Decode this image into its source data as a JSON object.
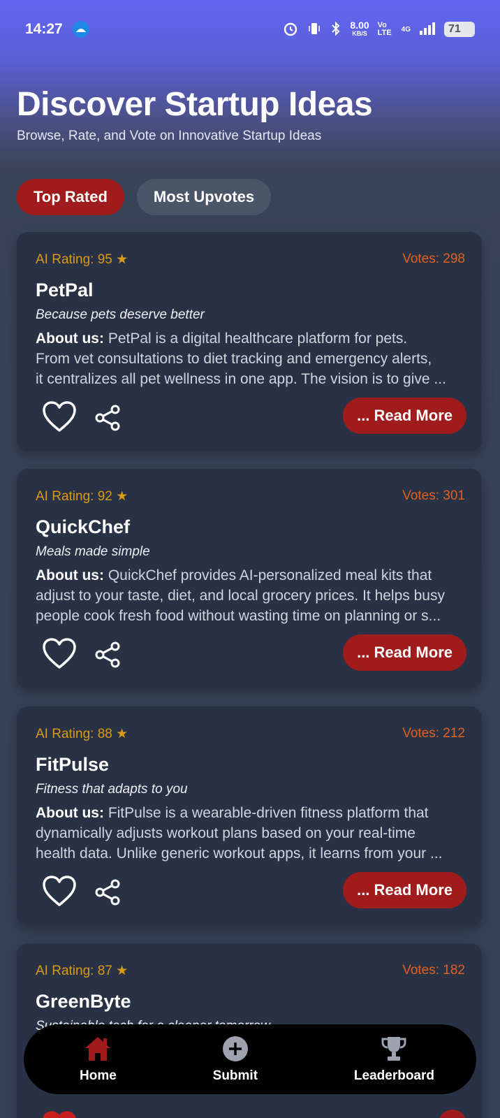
{
  "status_bar": {
    "time": "14:27",
    "speed_value": "8.00",
    "speed_unit": "KB/S",
    "volte": "Vo LTE",
    "network": "4G",
    "battery": "71"
  },
  "header": {
    "title": "Discover Startup Ideas",
    "subtitle": "Browse, Rate, and Vote on Innovative Startup Ideas"
  },
  "tabs": [
    {
      "label": "Top Rated",
      "active": true
    },
    {
      "label": "Most Upvotes",
      "active": false
    }
  ],
  "about_label": "About us:",
  "read_more_label": "... Read More",
  "cards": [
    {
      "rating": "AI Rating: 95 ★",
      "votes": "Votes: 298",
      "name": "PetPal",
      "tagline": "Because pets deserve better",
      "about_lines": [
        " PetPal is a digital healthcare platform for pets.",
        "From vet consultations to diet tracking and emergency alerts,",
        "it centralizes all pet wellness in one app. The vision is to give ..."
      ]
    },
    {
      "rating": "AI Rating: 92 ★",
      "votes": "Votes: 301",
      "name": "QuickChef",
      "tagline": "Meals made simple",
      "about_lines": [
        " QuickChef provides AI-personalized meal kits that",
        "adjust to your taste, diet, and local grocery prices. It helps busy",
        "people cook fresh food without wasting time on planning or s..."
      ]
    },
    {
      "rating": "AI Rating: 88 ★",
      "votes": "Votes: 212",
      "name": "FitPulse",
      "tagline": "Fitness that adapts to you",
      "about_lines": [
        " FitPulse is a wearable-driven fitness platform that",
        "dynamically adjusts workout plans based on your real-time",
        "health data. Unlike generic workout apps, it learns from your ..."
      ]
    },
    {
      "rating": "AI Rating: 87 ★",
      "votes": "Votes: 182",
      "name": "GreenByte",
      "tagline": "Sustainable tech for a cleaner tomorrow"
    }
  ],
  "bottom_nav": [
    {
      "label": "Home",
      "icon": "home-icon",
      "color": "#a01c1c"
    },
    {
      "label": "Submit",
      "icon": "plus-circle-icon",
      "color": "#9ca3af"
    },
    {
      "label": "Leaderboard",
      "icon": "trophy-icon",
      "color": "#9ca3af"
    }
  ],
  "colors": {
    "accent": "#a01c1c",
    "header_gradient_top": "#6366f1",
    "rating": "#d99a16",
    "votes": "#e0601f",
    "card_bg": "#283244"
  }
}
